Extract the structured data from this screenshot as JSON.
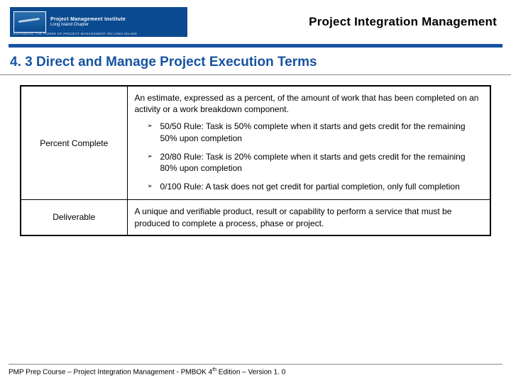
{
  "header": {
    "logo_main": "Project Management Institute",
    "logo_sub": "Long Island Chapter",
    "logo_tagline": "EXPANDING THE POWER OF PROJECT MANAGEMENT ON LONG ISLAND",
    "title": "Project Integration Management"
  },
  "section": {
    "number_title": "4. 3 Direct and Manage Project Execution Terms"
  },
  "terms": [
    {
      "label": "Percent Complete",
      "definition": "An estimate, expressed as a percent, of the amount of work that has been completed on an activity or a work breakdown component.",
      "rules": [
        "50/50 Rule: Task is 50% complete when it starts and gets credit for the remaining 50% upon completion",
        "20/80 Rule: Task is 20% complete when it starts and gets credit for the remaining 80% upon completion",
        "0/100 Rule: A task does not get credit for partial completion, only full completion"
      ]
    },
    {
      "label": "Deliverable",
      "definition": "A unique and verifiable product, result or capability to perform a service that must be produced to complete a process, phase or project."
    }
  ],
  "footer": {
    "text_pre": "PMP Prep Course – Project Integration Management - PMBOK 4",
    "text_sup": "th",
    "text_post": " Edition – Version 1. 0"
  }
}
